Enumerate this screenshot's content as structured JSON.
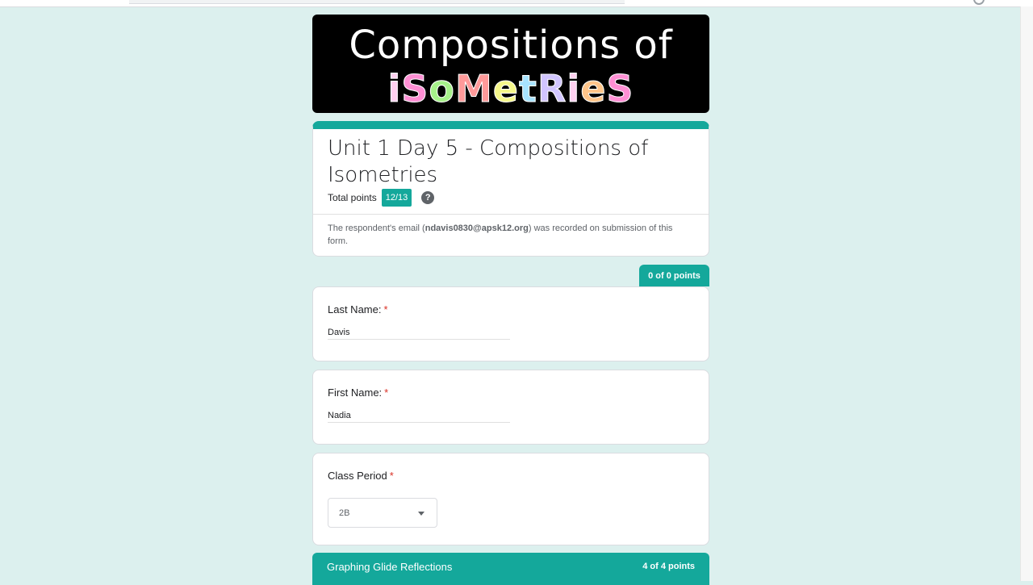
{
  "banner": {
    "line1": "Compositions of",
    "line2_letters": [
      {
        "ch": "i",
        "color": "#ffd0f0"
      },
      {
        "ch": "S",
        "color": "#ff8fd4"
      },
      {
        "ch": "o",
        "color": "#a6f08a"
      },
      {
        "ch": "M",
        "color": "#ff9a9a"
      },
      {
        "ch": "e",
        "color": "#f5f78a"
      },
      {
        "ch": "t",
        "color": "#a7e3ff"
      },
      {
        "ch": "R",
        "color": "#d1c5ff"
      },
      {
        "ch": "i",
        "color": "#ffd0f0"
      },
      {
        "ch": "e",
        "color": "#ffc58a"
      },
      {
        "ch": "S",
        "color": "#ff8fd4"
      }
    ]
  },
  "form": {
    "title": "Unit 1 Day 5 - Compositions of Isometries",
    "total_points_label": "Total points",
    "score": "12/13",
    "help_glyph": "?",
    "email_note_prefix": "The respondent's email (",
    "email": "ndavis0830@apsk12.org",
    "email_note_suffix": ") was recorded on submission of this form."
  },
  "section0": {
    "points": "0 of 0 points"
  },
  "questions": [
    {
      "label": "Last Name:",
      "required": "*",
      "answer": "Davis"
    },
    {
      "label": "First Name:",
      "required": "*",
      "answer": "Nadia"
    },
    {
      "label": "Class Period",
      "required": "*",
      "answer": "2B"
    }
  ],
  "section1": {
    "title": "Graphing Glide Reflections",
    "points": "4 of 4 points"
  },
  "colors": {
    "accent": "#14a89b",
    "background": "#dcf0ee",
    "required": "#d93025"
  }
}
